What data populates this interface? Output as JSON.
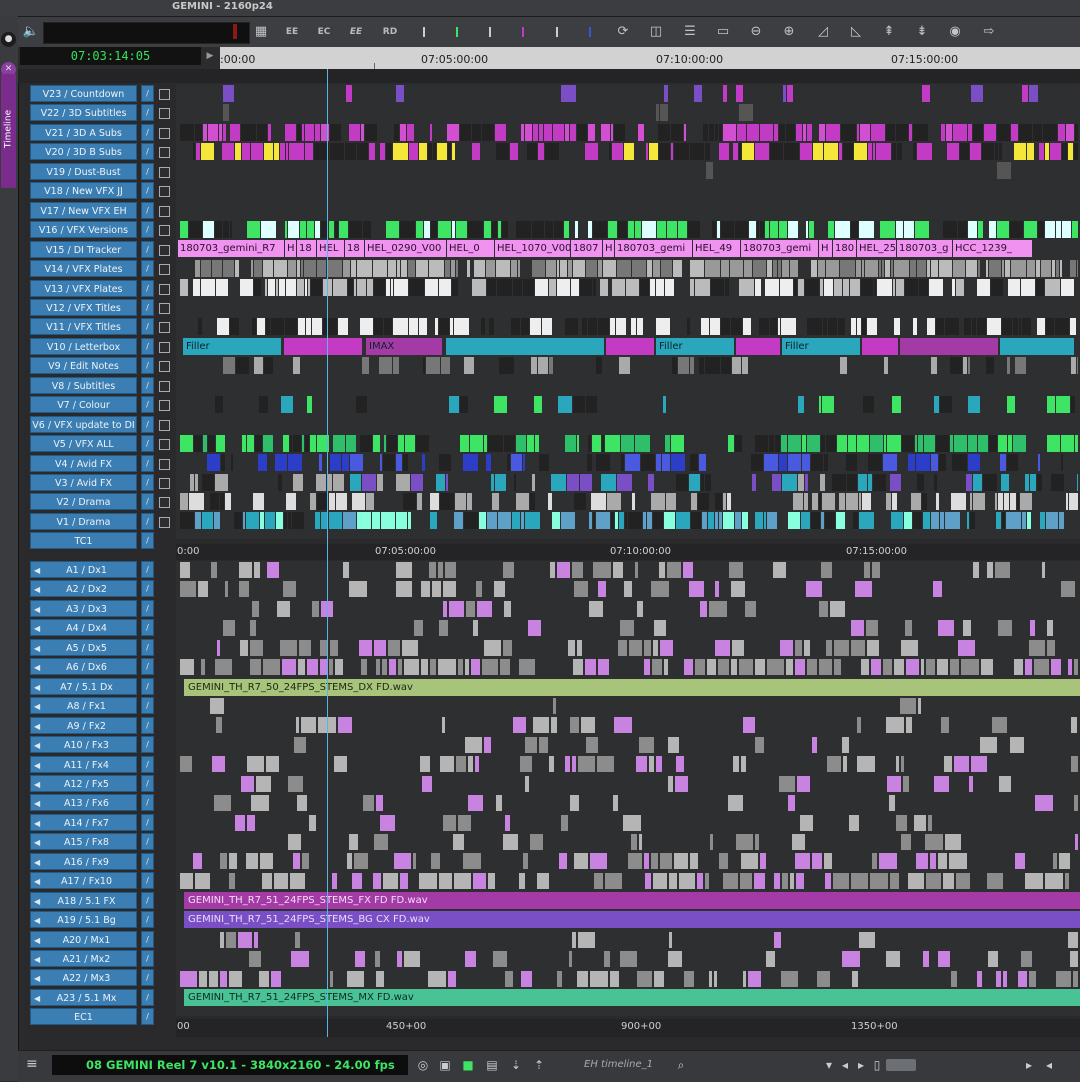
{
  "window": {
    "title": "GEMINI - 2160p24"
  },
  "left_strip": {
    "tab_label": "Timeline"
  },
  "toolbar": {
    "buttons": [
      "EE",
      "EC",
      "EE",
      "RD"
    ],
    "icons": [
      "speaker-icon",
      "grid-icon",
      "refresh-icon",
      "split-icon",
      "sliders-icon",
      "folder-icon",
      "zoom-out-icon",
      "zoom-in-icon",
      "trim-icon",
      "trim-icon",
      "lift-icon",
      "extract-icon",
      "record-icon",
      "overwrite-icon"
    ]
  },
  "timecode": {
    "value": "07:03:14:05"
  },
  "ruler_top": {
    "labels": [
      ":00:00",
      "07:05:00:00",
      "07:10:00:00",
      "07:15:00:00"
    ]
  },
  "video_tracks": [
    "V23 / Countdown",
    "V22 / 3D Subtitles",
    "V21 / 3D A Subs",
    "V20 / 3D B Subs",
    "V19 / Dust-Bust",
    "V18 / New VFX JJ",
    "V17 / New VFX EH",
    "V16 / VFX Versions",
    "V15 / DI Tracker",
    "V14 / VFX Plates",
    "V13 / VFX Plates",
    "V12 / VFX Titles",
    "V11 / VFX Titles",
    "V10 / Letterbox",
    "V9 / Edit Notes",
    "V8 / Subtitles",
    "V7 / Colour",
    "V6 / VFX update to DI",
    "V5 / VFX ALL",
    "V4 / Avid FX",
    "V3 / Avid FX",
    "V2 / Drama",
    "V1 / Drama"
  ],
  "tc_track": "TC1",
  "mid_ruler": {
    "labels": [
      "0:00",
      "07:05:00:00",
      "07:10:00:00",
      "07:15:00:00"
    ]
  },
  "audio_tracks": [
    "A1 / Dx1",
    "A2 / Dx2",
    "A3 / Dx3",
    "A4 / Dx4",
    "A5 / Dx5",
    "A6 / Dx6",
    "A7 / 5.1 Dx",
    "A8 / Fx1",
    "A9 / Fx2",
    "A10 / Fx3",
    "A11 / Fx4",
    "A12 / Fx5",
    "A13 / Fx6",
    "A14 / Fx7",
    "A15 / Fx8",
    "A16 / Fx9",
    "A17 / Fx10",
    "A18 / 5.1 FX",
    "A19 / 5.1 Bg",
    "A20 / Mx1",
    "A21 / Mx2",
    "A22 / Mx3",
    "A23 / 5.1 Mx"
  ],
  "ec_track": "EC1",
  "v15_clips": [
    "180703_gemini_R7",
    "H",
    "18",
    "HEL",
    "18",
    "HEL_0290_V00",
    "HEL_0",
    "HEL_1070_V00",
    "1807",
    "H",
    "180703_gemi",
    "HEL_49",
    "180703_gemi",
    "H",
    "180",
    "HEL_25",
    "180703_g",
    "HCC_1239_"
  ],
  "v10_clips": [
    "Filler",
    "IMAX",
    "Filler",
    "Filler"
  ],
  "audio_long_clips": {
    "a7": "GEMINI_TH_R7_50_24FPS_STEMS_DX FD.wav",
    "a18": "GEMINI_TH_R7_51_24FPS_STEMS_FX FD FD.wav",
    "a19": "GEMINI_TH_R7_51_24FPS_STEMS_BG CX FD.wav",
    "a23": "GEMINI_TH_R7_51_24FPS_STEMS_MX FD.wav"
  },
  "bottom_ruler": {
    "labels": [
      "00",
      "450+00",
      "900+00",
      "1350+00"
    ]
  },
  "bottom_bar": {
    "sequence_info": "08  GEMINI  Reel 7  v10.1 - 3840x2160 - 24.00 fps",
    "timeline_name": "EH timeline_1"
  },
  "colors": {
    "track_header": "#3b7eb3",
    "magenta": "#c33bc4",
    "pink_clip": "#f092f0",
    "cyan": "#2aa6bd",
    "green": "#3ee463",
    "audio_green": "#a8c47a",
    "fx_purple": "#a33aa6",
    "bg_violet": "#7a4ec4",
    "mx_teal": "#49c296"
  }
}
